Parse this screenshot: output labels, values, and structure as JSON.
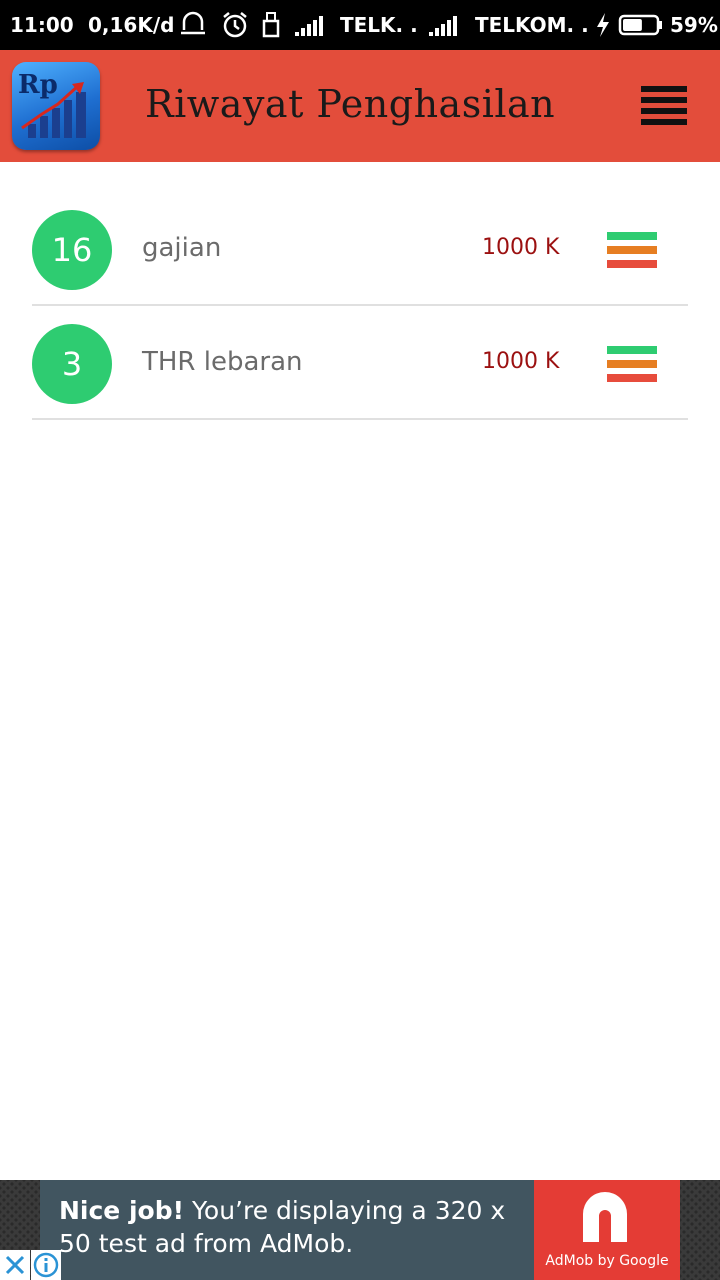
{
  "status_bar": {
    "time": "11:00",
    "data_speed": "0,16K/d",
    "carrier_1": "TELK. .",
    "carrier_2": "TELKOM. .",
    "battery_percent": "59%",
    "battery_level": 0.59
  },
  "app_bar": {
    "logo_text": "Rp",
    "title": "Riwayat Penghasilan"
  },
  "items": [
    {
      "day": "16",
      "name": "gajian",
      "amount": "1000 K"
    },
    {
      "day": "3",
      "name": "THR lebaran",
      "amount": "1000 K"
    }
  ],
  "ad": {
    "headline_bold": "Nice job!",
    "headline_rest": " You’re displaying a 320 x 50 test ad from AdMob.",
    "brand": "AdMob by Google"
  },
  "colors": {
    "app_bar": "#e34d3b",
    "badge": "#2ecc71",
    "amount": "#9b1010",
    "bar_green": "#2ecc71",
    "bar_orange": "#e67e22",
    "bar_red": "#e74c3c",
    "ad_background": "#415560",
    "ad_logo": "#e43c35"
  }
}
